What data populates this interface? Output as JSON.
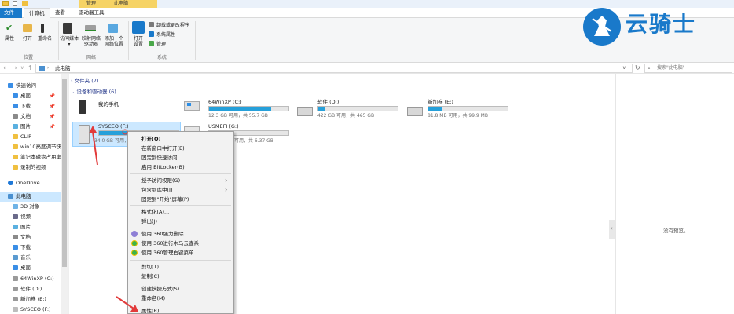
{
  "window": {
    "title": "此电脑",
    "context_tab": "管理"
  },
  "ribbon": {
    "tabs": [
      "文件",
      "计算机",
      "查看",
      "驱动器工具"
    ],
    "location_group": {
      "label": "位置",
      "buttons": [
        "属性",
        "打开",
        "重命名"
      ]
    },
    "network_group": {
      "label": "网络",
      "buttons": [
        [
          "访问媒体"
        ],
        [
          "映射网络",
          "驱动器"
        ],
        [
          "添加一个",
          "网络位置"
        ]
      ]
    },
    "system_group": {
      "label": "系统",
      "open_settings": [
        "打开",
        "设置"
      ],
      "items": [
        "卸载或更改程序",
        "系统属性",
        "管理"
      ]
    }
  },
  "address": {
    "path": "此电脑",
    "search_placeholder": "搜索\"此电脑\""
  },
  "nav": {
    "items": [
      {
        "label": "快速访问",
        "pinned": false
      },
      {
        "label": "桌面",
        "pinned": true
      },
      {
        "label": "下载",
        "pinned": true
      },
      {
        "label": "文档",
        "pinned": true
      },
      {
        "label": "图片",
        "pinned": true
      },
      {
        "label": "CLIP",
        "pinned": false
      },
      {
        "label": "win10亮度调节快",
        "pinned": false
      },
      {
        "label": "笔记本磁盘占用率",
        "pinned": false
      },
      {
        "label": "录制的视频",
        "pinned": false
      },
      {
        "label": "OneDrive",
        "pinned": false
      },
      {
        "label": "此电脑",
        "pinned": false
      },
      {
        "label": "3D 对象",
        "pinned": false
      },
      {
        "label": "视频",
        "pinned": false
      },
      {
        "label": "图片",
        "pinned": false
      },
      {
        "label": "文档",
        "pinned": false
      },
      {
        "label": "下载",
        "pinned": false
      },
      {
        "label": "音乐",
        "pinned": false
      },
      {
        "label": "桌面",
        "pinned": false
      },
      {
        "label": "64WinXP (C:)",
        "pinned": false
      },
      {
        "label": "软件 (D:)",
        "pinned": false
      },
      {
        "label": "新加卷 (E:)",
        "pinned": false
      },
      {
        "label": "SYSCEO (F:)",
        "pinned": false
      }
    ]
  },
  "main": {
    "folders_header": "文件夹 (7)",
    "devices_header": "设备和驱动器 (6)",
    "devices": [
      {
        "name": "我的手机",
        "size": "",
        "fill": null
      },
      {
        "name": "64WinXP (C:)",
        "size": "12.3 GB 可用，共 55.7 GB",
        "fill": 0.78
      },
      {
        "name": "软件 (D:)",
        "size": "422 GB 可用，共 465 GB",
        "fill": 0.09
      },
      {
        "name": "新加卷 (E:)",
        "size": "81.8 MB 可用，共 99.9 MB",
        "fill": 0.18
      },
      {
        "name": "SYSCEO (F:)",
        "size": "34.0 GB 可用，共",
        "fill": 0.35
      },
      {
        "name": "USMEFI (G:)",
        "size": "可用，共 6.37 GB",
        "fill": 0.0
      }
    ],
    "preview_text": "没有预览。"
  },
  "context_menu": {
    "items": [
      "打开(O)",
      "在新窗口中打开(E)",
      "固定到快速访问",
      "启用 BitLocker(B)",
      "授予访问权限(G)",
      "包含到库中(I)",
      "固定到\"开始\"屏幕(P)",
      "格式化(A)...",
      "弹出(J)",
      "使用 360强力删除",
      "使用 360进行木马云查杀",
      "使用 360管理右键菜单",
      "剪切(T)",
      "复制(C)",
      "创建快捷方式(S)",
      "重命名(M)",
      "属性(R)"
    ]
  },
  "watermark": {
    "text": "云骑士"
  },
  "colors": {
    "accent": "#1979ca",
    "drive_fill": "#26a0da",
    "selection": "#cce8ff",
    "annotation_arrow": "#e23a3a"
  }
}
